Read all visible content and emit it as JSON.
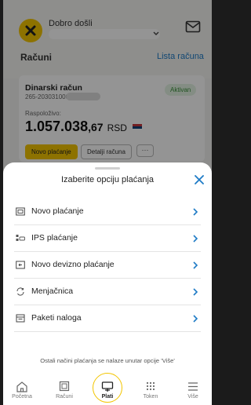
{
  "header": {
    "greeting": "Dobro došli"
  },
  "accounts_section": {
    "title": "Računi",
    "link": "Lista računa"
  },
  "account_card": {
    "title": "Dinarski račun",
    "number": "265-203031000",
    "status": "Aktivan",
    "balance_label": "Raspoloživo:",
    "balance_main": "1.057.038",
    "balance_cents": ",67",
    "currency": "RSD",
    "new_payment_button": "Novo plaćanje",
    "details_button": "Detalji računa",
    "more_button": "···"
  },
  "sheet": {
    "title": "Izaberite opciju plaćanja",
    "options": [
      {
        "label": "Novo plaćanje",
        "icon": "payment-slip-icon"
      },
      {
        "label": "IPS plaćanje",
        "icon": "ips-qr-icon"
      },
      {
        "label": "Novo devizno plaćanje",
        "icon": "foreign-payment-icon"
      },
      {
        "label": "Menjačnica",
        "icon": "currency-exchange-icon"
      },
      {
        "label": "Paketi naloga",
        "icon": "order-package-icon"
      }
    ],
    "note": "Ostali načini plaćanja se nalaze unutar opcije 'Više'"
  },
  "tabbar": {
    "tabs": [
      {
        "label": "Početna",
        "icon": "home-icon"
      },
      {
        "label": "Računi",
        "icon": "accounts-icon"
      },
      {
        "label": "Plati",
        "icon": "pay-icon"
      },
      {
        "label": "Token",
        "icon": "token-icon"
      },
      {
        "label": "Više",
        "icon": "menu-icon"
      }
    ],
    "active": "Plati"
  },
  "colors": {
    "brand_yellow": "#f3c500",
    "link_blue": "#1e7bc6",
    "status_green": "#3a8f3a"
  }
}
